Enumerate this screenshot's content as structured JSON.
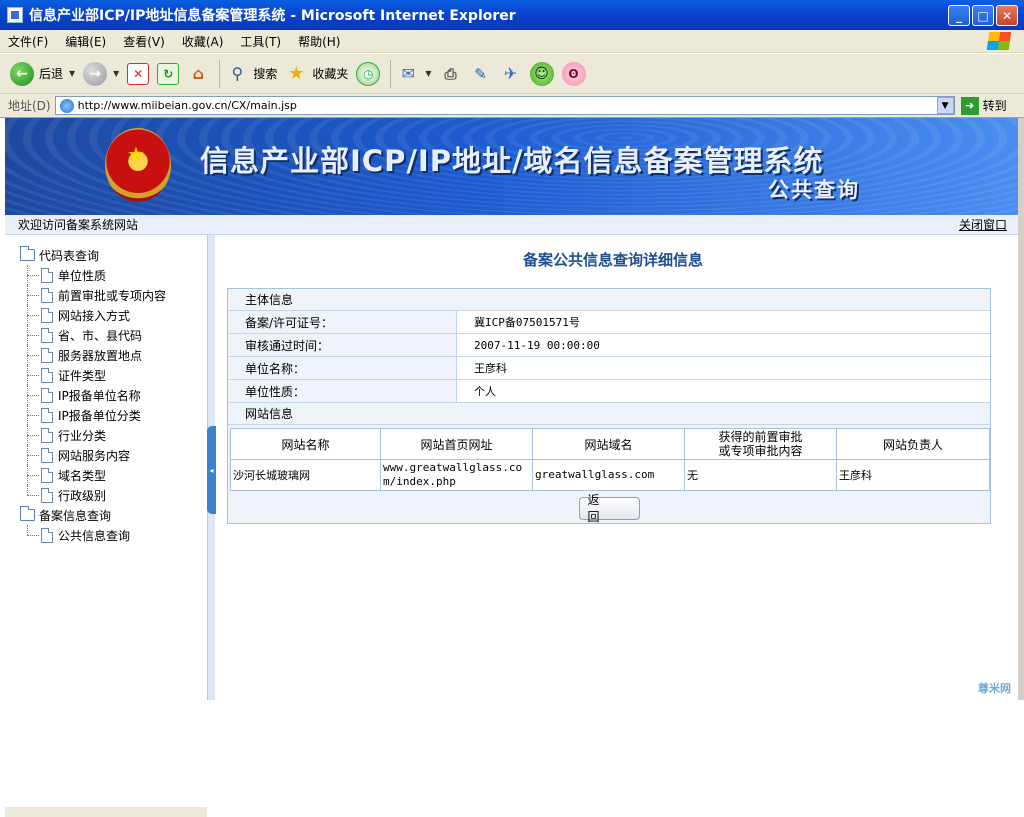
{
  "window": {
    "title": "信息产业部ICP/IP地址信息备案管理系统 - Microsoft Internet Explorer",
    "buttons": {
      "minimize": "_",
      "maximize": "□",
      "close": "✕"
    }
  },
  "menu": [
    "文件(F)",
    "编辑(E)",
    "查看(V)",
    "收藏(A)",
    "工具(T)",
    "帮助(H)"
  ],
  "toolbar": {
    "back": "后退",
    "search": "搜索",
    "favorites": "收藏夹"
  },
  "address": {
    "label": "地址(D)",
    "url": "http://www.miibeian.gov.cn/CX/main.jsp",
    "go": "转到"
  },
  "banner": {
    "title": "信息产业部ICP/IP地址/域名信息备案管理系统",
    "subtitle": "公共查询"
  },
  "welcome": {
    "text": "欢迎访问备案系统网站",
    "close": "关闭窗口"
  },
  "sidebar": {
    "groups": [
      {
        "label": "代码表查询",
        "items": [
          "单位性质",
          "前置审批或专项内容",
          "网站接入方式",
          "省、市、县代码",
          "服务器放置地点",
          "证件类型",
          "IP报备单位名称",
          "IP报备单位分类",
          "行业分类",
          "网站服务内容",
          "域名类型",
          "行政级别"
        ]
      },
      {
        "label": "备案信息查询",
        "items": [
          "公共信息查询"
        ]
      }
    ]
  },
  "main": {
    "heading": "备案公共信息查询详细信息",
    "section_subject": "主体信息",
    "rows": [
      {
        "k": "备案/许可证号：",
        "v": "冀ICP备07501571号"
      },
      {
        "k": "审核通过时间：",
        "v": "2007-11-19 00:00:00"
      },
      {
        "k": "单位名称：",
        "v": "王彦科"
      },
      {
        "k": "单位性质：",
        "v": "个人"
      }
    ],
    "section_site": "网站信息",
    "table": {
      "headers": [
        "网站名称",
        "网站首页网址",
        "网站域名",
        "获得的前置审批\n或专项审批内容",
        "网站负责人"
      ],
      "row": [
        "沙河长城玻璃网",
        "www.greatwallglass.com/index.php",
        "greatwallglass.com",
        "无",
        "王彦科"
      ]
    },
    "return_button": "返 回"
  },
  "watermark": "尊米网"
}
